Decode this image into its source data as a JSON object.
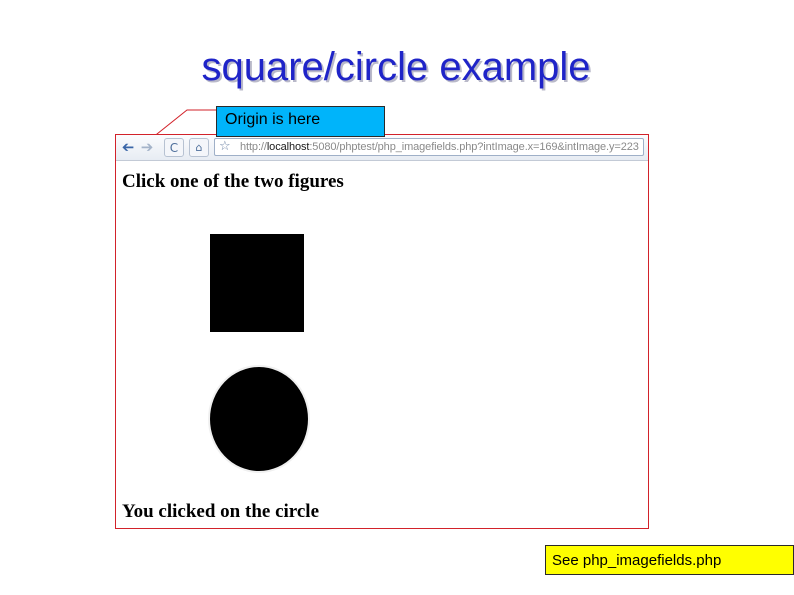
{
  "slide": {
    "title": "square/circle example"
  },
  "callout": {
    "label": "Origin is here"
  },
  "browser": {
    "toolbar": {
      "back_glyph": "➔",
      "forward_glyph": "➔",
      "reload_glyph": "C",
      "home_glyph": "⌂",
      "bookmark_glyph": "☆"
    },
    "address": {
      "scheme": "http://",
      "host": "localhost",
      "rest": ":5080/phptest/php_imagefields.php?intImage.x=169&intImage.y=223"
    },
    "page": {
      "heading": "Click one of the two figures",
      "result": "You clicked on the circle"
    }
  },
  "footnote": {
    "text": "See php_imagefields.php"
  },
  "colors": {
    "title": "#1f24c8",
    "callout_fill": "#00b4fa",
    "footnote_fill": "#ffff00",
    "browser_border": "#d2222a"
  },
  "icons": [
    "back-arrow-icon",
    "forward-arrow-icon",
    "reload-icon",
    "home-icon",
    "bookmark-star-icon"
  ]
}
